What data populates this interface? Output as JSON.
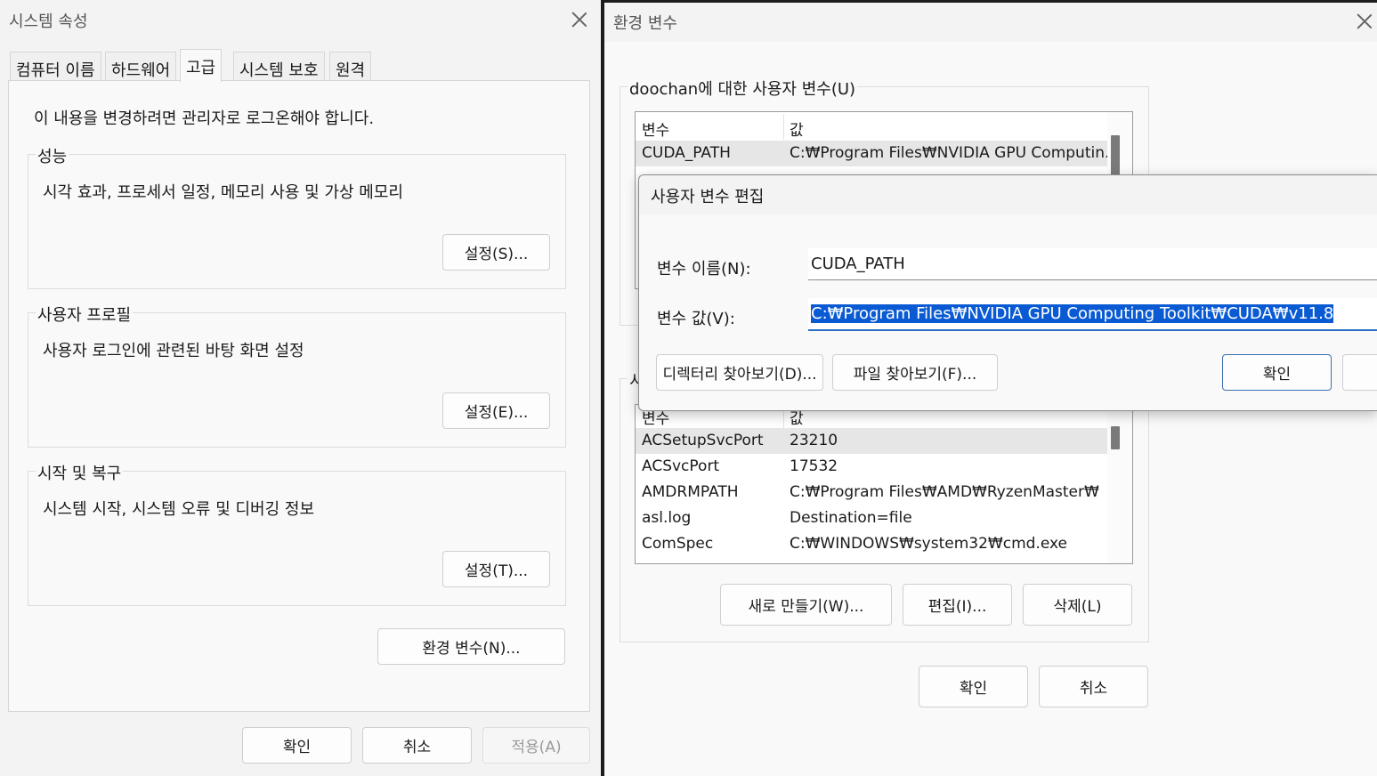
{
  "sys_props": {
    "title": "시스템 속성",
    "tabs": [
      "컴퓨터 이름",
      "하드웨어",
      "고급",
      "시스템 보호",
      "원격"
    ],
    "admin_note": "이 내용을 변경하려면 관리자로 로그온해야 합니다.",
    "performance": {
      "label": "성능",
      "desc": "시각 효과, 프로세서 일정, 메모리 사용 및 가상 메모리",
      "button": "설정(S)..."
    },
    "user_profile": {
      "label": "사용자 프로필",
      "desc": "사용자 로그인에 관련된 바탕 화면 설정",
      "button": "설정(E)..."
    },
    "startup": {
      "label": "시작 및 복구",
      "desc": "시스템 시작, 시스템 오류 및 디버깅 정보",
      "button": "설정(T)..."
    },
    "env_button": "환경 변수(N)...",
    "ok": "확인",
    "cancel": "취소",
    "apply": "적용(A)"
  },
  "env_vars": {
    "title": "환경 변수",
    "user_group_label": "doochan에 대한 사용자 변수(U)",
    "col_var": "변수",
    "col_val": "값",
    "user_rows": [
      {
        "name": "CUDA_PATH",
        "value": "C:₩Program Files₩NVIDIA GPU Computin..."
      }
    ],
    "system_group_label": "시",
    "system_rows": [
      {
        "name": "ACSetupSvcPort",
        "value": "23210"
      },
      {
        "name": "ACSvcPort",
        "value": "17532"
      },
      {
        "name": "AMDRMPATH",
        "value": "C:₩Program Files₩AMD₩RyzenMaster₩"
      },
      {
        "name": "asl.log",
        "value": "Destination=file"
      },
      {
        "name": "ComSpec",
        "value": "C:₩WINDOWS₩system32₩cmd.exe"
      }
    ],
    "new_button": "새로 만들기(W)...",
    "edit_button": "편집(I)...",
    "delete_button": "삭제(L)",
    "ok": "확인",
    "cancel": "취소"
  },
  "edit_dialog": {
    "title": "사용자 변수 편집",
    "name_label": "변수 이름(N):",
    "name_value": "CUDA_PATH",
    "value_label": "변수 값(V):",
    "value_value": "C:₩Program Files₩NVIDIA GPU Computing Toolkit₩CUDA₩v11.8",
    "browse_dir": "디렉터리 찾아보기(D)...",
    "browse_file": "파일 찾아보기(F)...",
    "ok": "확인"
  },
  "colors": {
    "accent": "#0a5bd3",
    "window_bg": "#f3f3f3",
    "panel_bg": "#f9f9f9"
  }
}
